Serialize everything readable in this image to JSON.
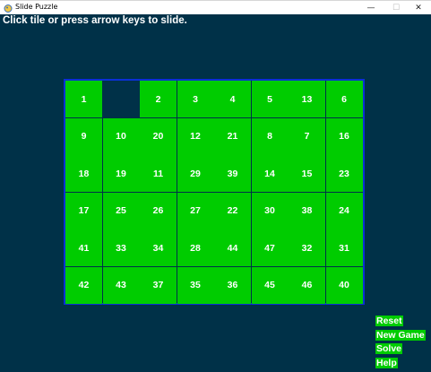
{
  "window": {
    "title": "Slide Puzzle",
    "minimize_glyph": "—",
    "maximize_glyph": "☐",
    "close_glyph": "✕"
  },
  "instructions": "Click tile or press arrow keys to slide.",
  "board": {
    "rows": 6,
    "cols": 8,
    "tiles": [
      [
        1,
        null,
        2,
        3,
        4,
        5,
        13,
        6
      ],
      [
        9,
        10,
        20,
        12,
        21,
        8,
        7,
        16
      ],
      [
        18,
        19,
        11,
        29,
        39,
        14,
        15,
        23
      ],
      [
        17,
        25,
        26,
        27,
        22,
        30,
        38,
        24
      ],
      [
        41,
        33,
        34,
        28,
        44,
        47,
        32,
        31
      ],
      [
        42,
        43,
        37,
        35,
        36,
        45,
        46,
        40
      ]
    ]
  },
  "buttons": {
    "reset": "Reset",
    "new_game": "New Game",
    "solve": "Solve",
    "help": "Help"
  },
  "colors": {
    "background": "#003148",
    "tile": "#00cc00",
    "tile_text": "#ffffff",
    "board_border": "#0b2fd4",
    "instruction_text": "#ffffff"
  }
}
